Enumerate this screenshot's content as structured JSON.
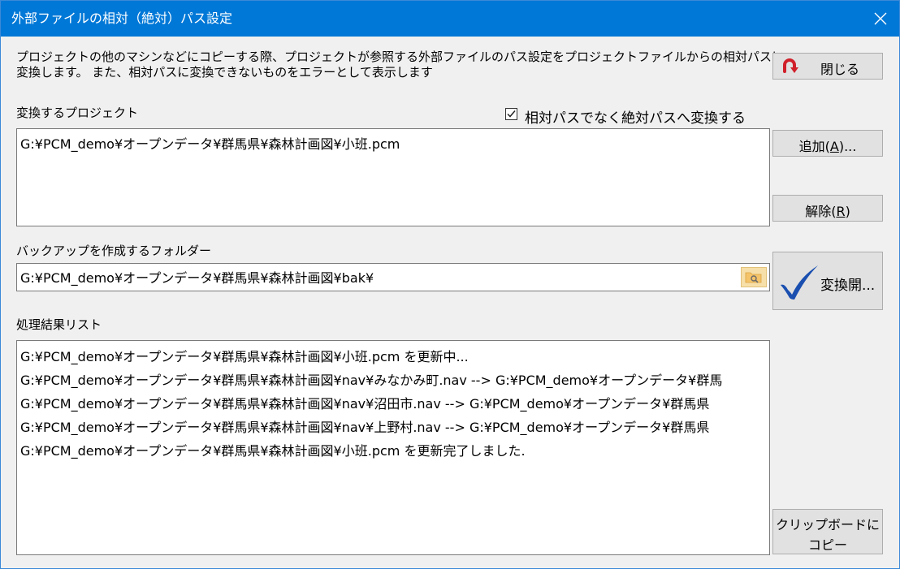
{
  "window": {
    "title": "外部ファイルの相対（絶対）パス設定"
  },
  "description": {
    "line1": "プロジェクトの他のマシンなどにコピーする際、プロジェクトが参照する外部ファイルのパス設定をプロジェクトファイルからの相対パスに",
    "line2": "変換します。 また、相対パスに変換できないものをエラーとして表示します"
  },
  "buttons": {
    "close_label": "閉じる",
    "add_label": "追加(",
    "add_mnemonic": "A",
    "add_suffix": ")...",
    "remove_label": "解除(",
    "remove_mnemonic": "R",
    "remove_suffix": ")",
    "convert_label": "変換開...",
    "copy_line1": "クリップボードに",
    "copy_line2": "コピー"
  },
  "project_section": {
    "label": "変換するプロジェクト",
    "checkbox_label": "相対パスでなく絶対パスへ変換する",
    "checkbox_checked": true,
    "items": [
      "G:¥PCM_demo¥オープンデータ¥群馬県¥森林計画図¥小班.pcm"
    ]
  },
  "backup_section": {
    "label": "バックアップを作成するフォルダー",
    "value": "G:¥PCM_demo¥オープンデータ¥群馬県¥森林計画図¥bak¥"
  },
  "result_section": {
    "label": "処理結果リスト",
    "lines": [
      "G:¥PCM_demo¥オープンデータ¥群馬県¥森林計画図¥小班.pcm を更新中...",
      "G:¥PCM_demo¥オープンデータ¥群馬県¥森林計画図¥nav¥みなかみ町.nav --> G:¥PCM_demo¥オープンデータ¥群馬",
      "G:¥PCM_demo¥オープンデータ¥群馬県¥森林計画図¥nav¥沼田市.nav --> G:¥PCM_demo¥オープンデータ¥群馬県",
      "G:¥PCM_demo¥オープンデータ¥群馬県¥森林計画図¥nav¥上野村.nav --> G:¥PCM_demo¥オープンデータ¥群馬県",
      "G:¥PCM_demo¥オープンデータ¥群馬県¥森林計画図¥小班.pcm を更新完了しました."
    ]
  },
  "colors": {
    "titlebar": "#0078d7",
    "close_icon_red": "#d0202a",
    "check_blue": "#1a4fb0",
    "folder_icon": "#f5c46a"
  },
  "icons": {
    "close_window": "close-x-icon",
    "close_dialog": "undo-arrow-icon",
    "convert": "checkmark-icon",
    "browse": "folder-search-icon"
  }
}
